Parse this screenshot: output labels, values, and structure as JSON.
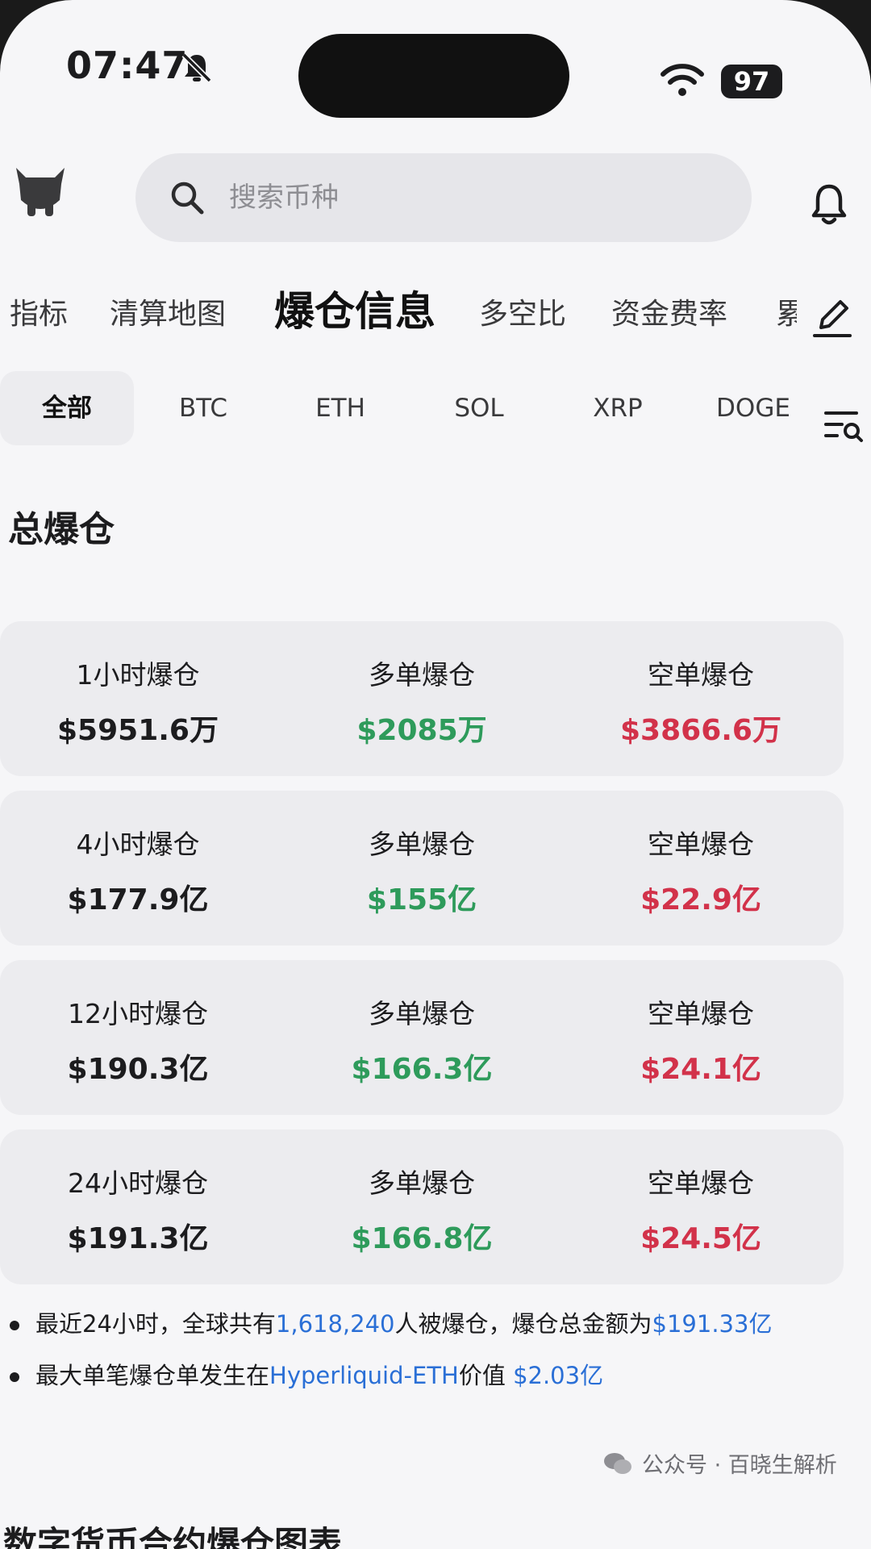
{
  "status": {
    "time": "07:47",
    "battery": "97"
  },
  "search": {
    "placeholder": "搜索币种"
  },
  "tabs": [
    {
      "label": "指标"
    },
    {
      "label": "清算地图"
    },
    {
      "label": "爆仓信息"
    },
    {
      "label": "多空比"
    },
    {
      "label": "资金费率"
    },
    {
      "label": "累"
    }
  ],
  "chips": [
    {
      "label": "全部"
    },
    {
      "label": "BTC"
    },
    {
      "label": "ETH"
    },
    {
      "label": "SOL"
    },
    {
      "label": "XRP"
    },
    {
      "label": "DOGE"
    }
  ],
  "section_title": "总爆仓",
  "cards": [
    {
      "total_label": "1小时爆仓",
      "total": "$5951.6万",
      "long_label": "多单爆仓",
      "long": "$2085万",
      "short_label": "空单爆仓",
      "short": "$3866.6万"
    },
    {
      "total_label": "4小时爆仓",
      "total": "$177.9亿",
      "long_label": "多单爆仓",
      "long": "$155亿",
      "short_label": "空单爆仓",
      "short": "$22.9亿"
    },
    {
      "total_label": "12小时爆仓",
      "total": "$190.3亿",
      "long_label": "多单爆仓",
      "long": "$166.3亿",
      "short_label": "空单爆仓",
      "short": "$24.1亿"
    },
    {
      "total_label": "24小时爆仓",
      "total": "$191.3亿",
      "long_label": "多单爆仓",
      "long": "$166.8亿",
      "short_label": "空单爆仓",
      "short": "$24.5亿"
    }
  ],
  "notes": {
    "n1_a": "最近24小时，全球共有",
    "n1_count": "1,618,240",
    "n1_b": "人被爆仓，爆仓总金额为",
    "n1_amount": "$191.33亿",
    "n2_a": "最大单笔爆仓单发生在",
    "n2_venue": "Hyperliquid-ETH",
    "n2_b": "价值 ",
    "n2_amount": "$2.03亿"
  },
  "watermark": "公众号 · 百晓生解析",
  "bottom_title": "数字货币合约爆仓图表",
  "colors": {
    "long": "#2e9b5b",
    "short": "#d2324a",
    "link": "#2a6fd6"
  }
}
